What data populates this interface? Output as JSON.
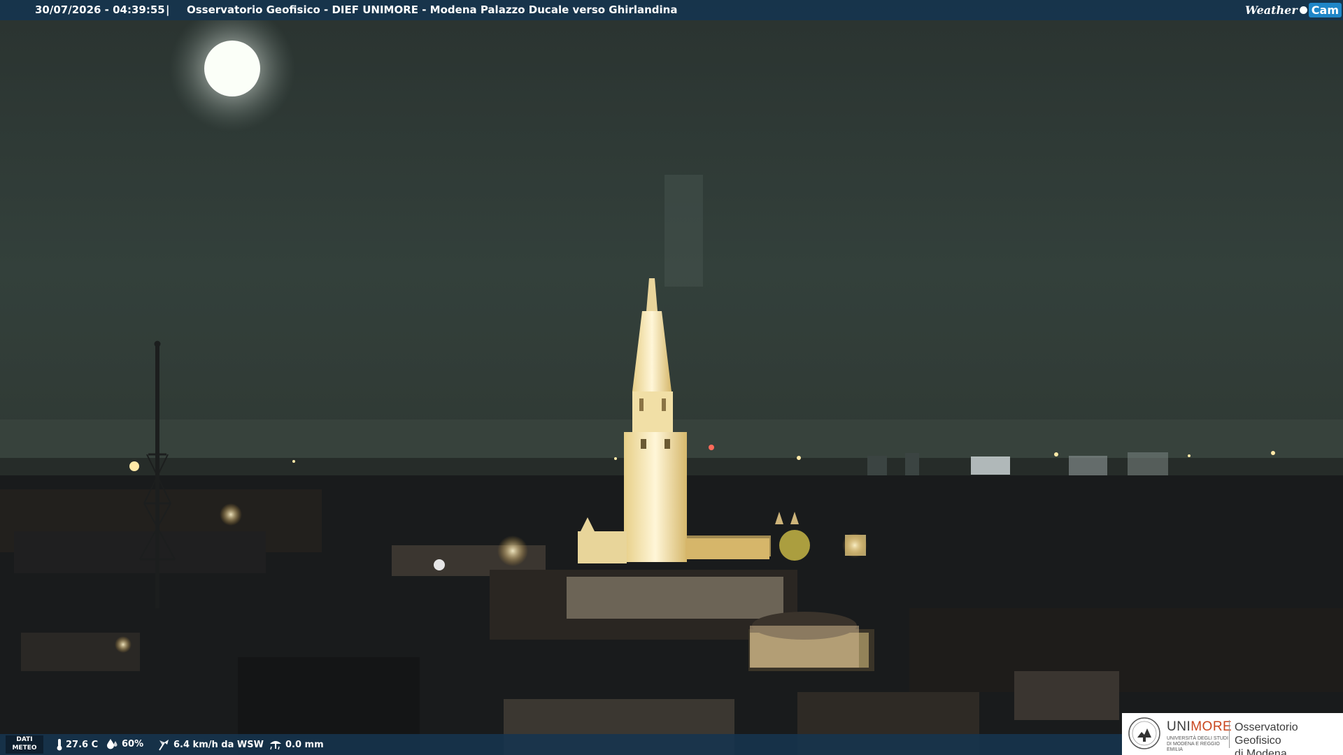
{
  "header": {
    "timestamp": "30/07/2026 - 04:39:55",
    "separator": "|",
    "title": "Osservatorio Geofisico - DIEF UNIMORE - Modena Palazzo Ducale verso Ghirlandina",
    "brand_word": "Weather",
    "brand_cam": "Cam"
  },
  "meteo": {
    "label_line1": "DATI",
    "label_line2": "METEO",
    "temperature": "27.6 C",
    "humidity": "60%",
    "wind": "6.4 km/h da WSW",
    "rain": "0.0 mm"
  },
  "logo": {
    "uni": "UNI",
    "more": "MORE",
    "uni_sub": "UNIVERSITÀ DEGLI STUDI DI MODENA E REGGIO EMILIA",
    "obs_line1": "Osservatorio Geofisico",
    "obs_line2": "di Modena"
  },
  "colors": {
    "bar": "#16344e",
    "sky": "#2f3a36",
    "tower_light": "#fff2c4",
    "brand_blue": "#1f86c8",
    "unimore_orange": "#c9461e"
  },
  "icons": [
    "thermometer-icon",
    "humidity-drop-icon",
    "wind-icon",
    "rain-gauge-icon",
    "unimore-seal-icon",
    "weathercam-logo"
  ]
}
